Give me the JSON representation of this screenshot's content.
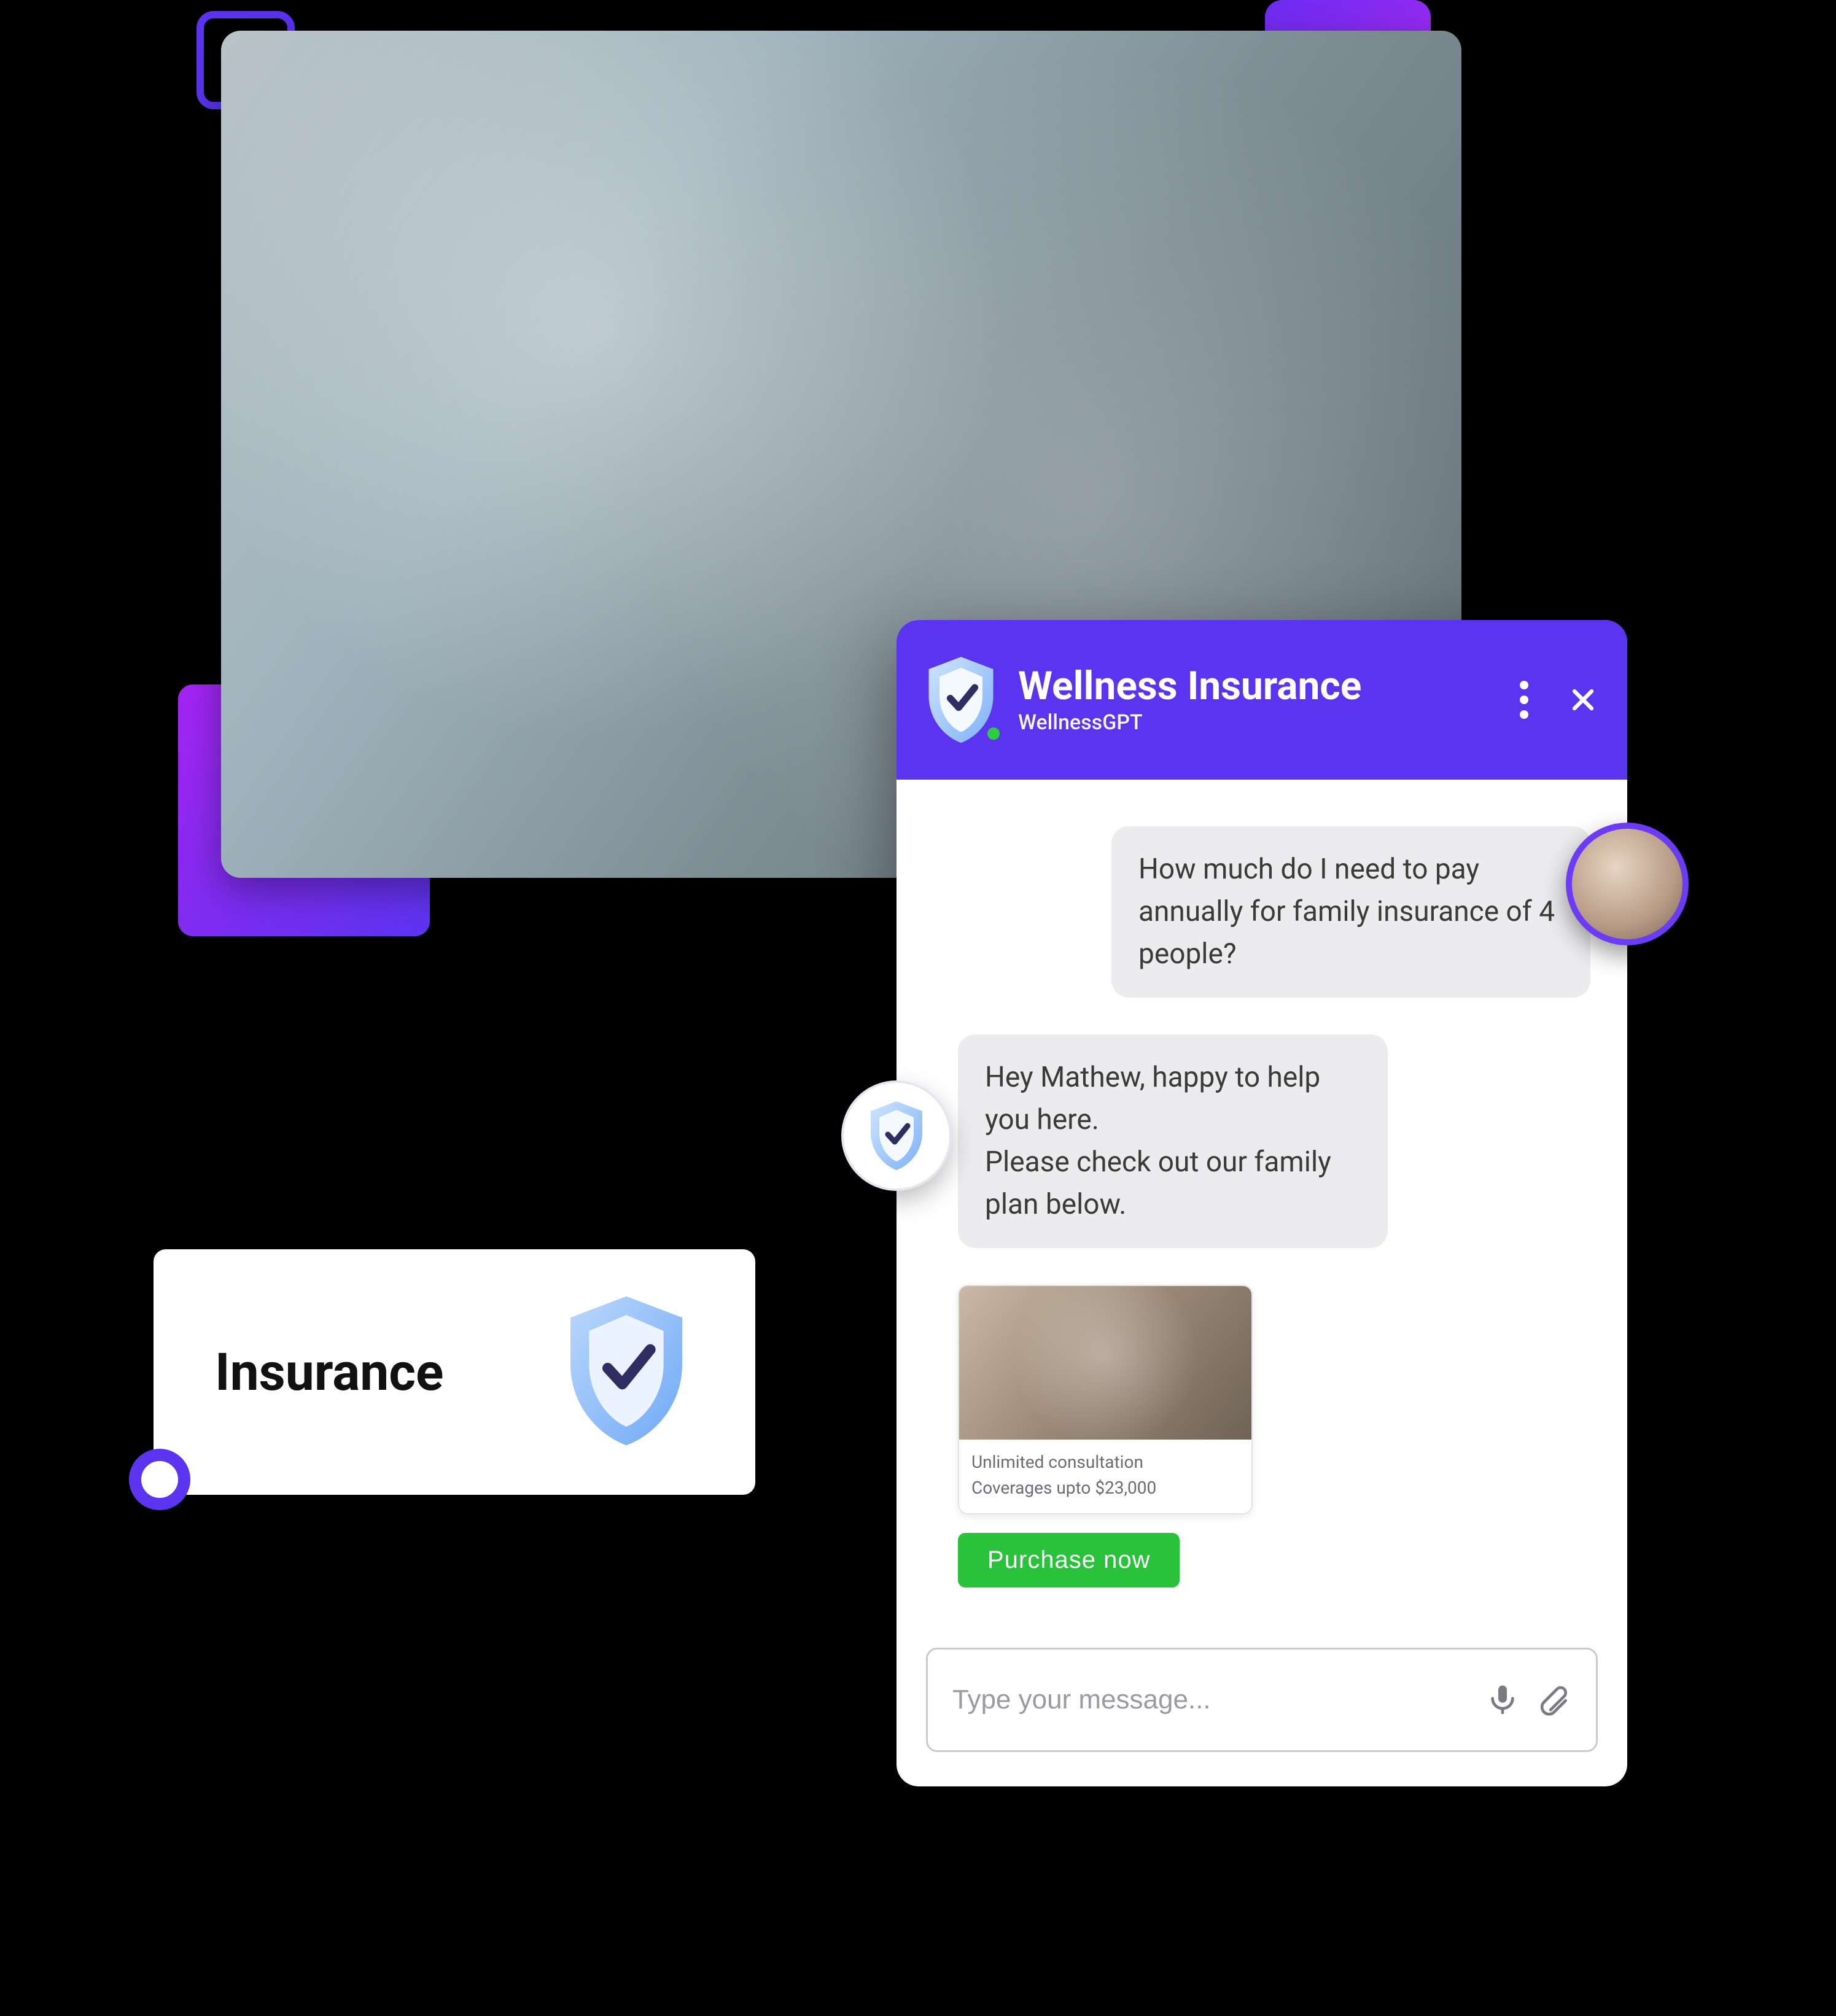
{
  "decor": {
    "accent_outline_color": "#5B34F0",
    "gradient_square": "#A524F2"
  },
  "insurance_card": {
    "label": "Insurance",
    "icon": "shield-check-icon"
  },
  "chat": {
    "header": {
      "title": "Wellness Insurance",
      "subtitle": "WellnessGPT",
      "status": "online",
      "icons": {
        "brand": "shield-check-icon",
        "menu": "kebab-icon",
        "close": "close-icon"
      }
    },
    "messages": {
      "user_1": "How much do I need to pay annually for family insurance of 4 people?",
      "bot_1_line1": "Hey Mathew, happy to help you here.",
      "bot_1_line2": "Please check out our family plan below."
    },
    "plan_card": {
      "line1": "Unlimited consultation",
      "line2": "Coverages upto $23,000"
    },
    "cta": {
      "purchase_label": "Purchase  now"
    },
    "input": {
      "placeholder": "Type your message...",
      "value": "",
      "icons": {
        "mic": "microphone-icon",
        "attach": "paperclip-icon"
      }
    }
  },
  "colors": {
    "brand_purple": "#5B34F0",
    "cta_green": "#29C23A",
    "bubble_grey": "#ECECEF"
  }
}
